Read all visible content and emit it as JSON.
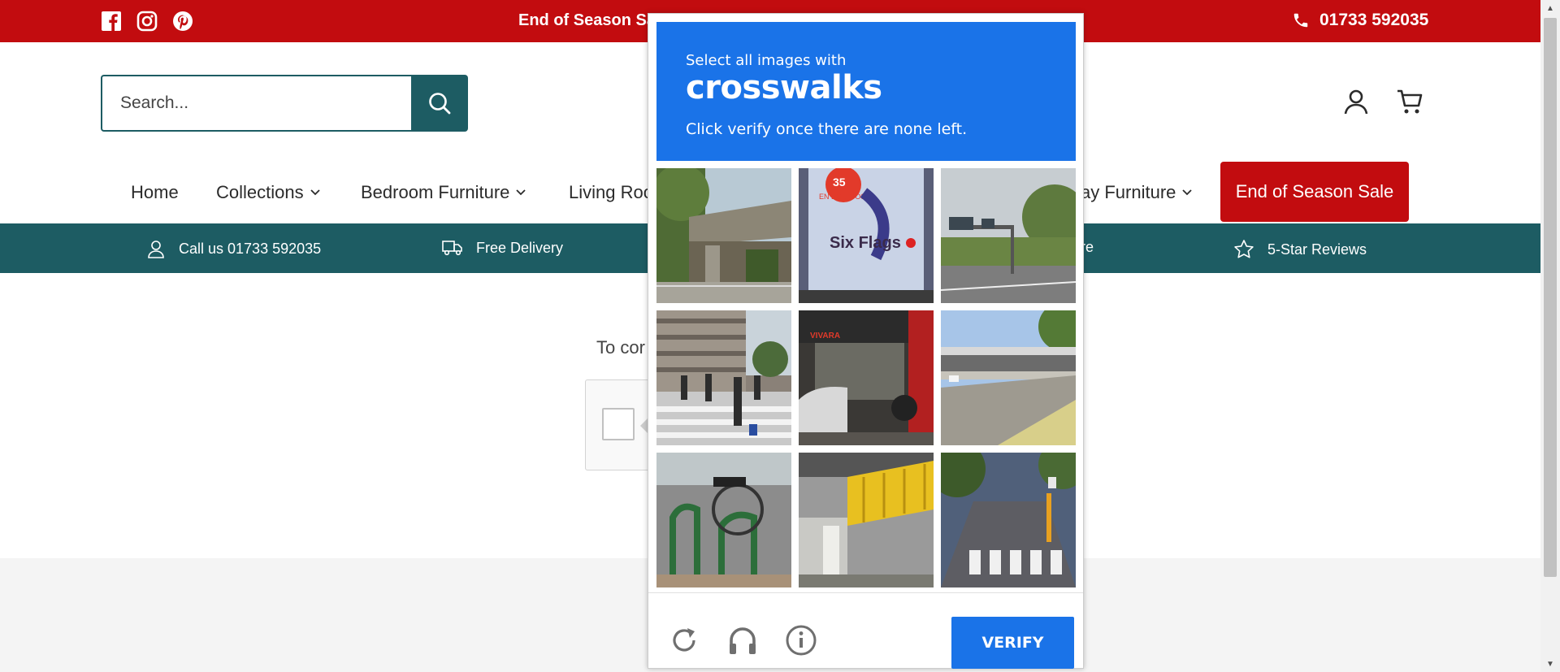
{
  "topbar": {
    "promo": "End of Season Sa",
    "phone": "01733 592035",
    "social": [
      "facebook-icon",
      "instagram-icon",
      "pinterest-icon"
    ],
    "color": "#c20c0f"
  },
  "search": {
    "placeholder": "Search..."
  },
  "nav": {
    "items": [
      {
        "label": "Home",
        "dropdown": false
      },
      {
        "label": "Collections",
        "dropdown": true
      },
      {
        "label": "Bedroom Furniture",
        "dropdown": true
      },
      {
        "label": "Living Roo",
        "dropdown": false
      },
      {
        "label": "ay Furniture",
        "dropdown": true
      }
    ],
    "sale_label": "End of Season Sale"
  },
  "usp": {
    "items": [
      {
        "label": "Call us 01733 592035",
        "icon": "user-icon"
      },
      {
        "label": "Free Delivery",
        "icon": "truck-icon"
      },
      {
        "label": "ore",
        "icon": ""
      },
      {
        "label": "5-Star Reviews",
        "icon": "star-icon"
      }
    ],
    "color": "#1d5c63"
  },
  "content": {
    "text": "To cor"
  },
  "challenge": {
    "instruction_small": "Select all images with",
    "target": "crosswalks",
    "instruction_sub": "Click verify once there are none left.",
    "verify_label": "VERIFY",
    "accent": "#1a73e8",
    "tiles": [
      "overpass-trees",
      "six-flags-poster",
      "highway-signs",
      "pedestrian-crossing-building",
      "cars-storefront",
      "bridge-road",
      "bicycle-rack",
      "yellow-barrier",
      "bike-lane-crosswalk"
    ],
    "tile_text": {
      "poster_big": "35",
      "poster_sub": "EN BOLETOS",
      "poster_brand": "Six Flags",
      "store_sign": "VIVARA"
    }
  }
}
